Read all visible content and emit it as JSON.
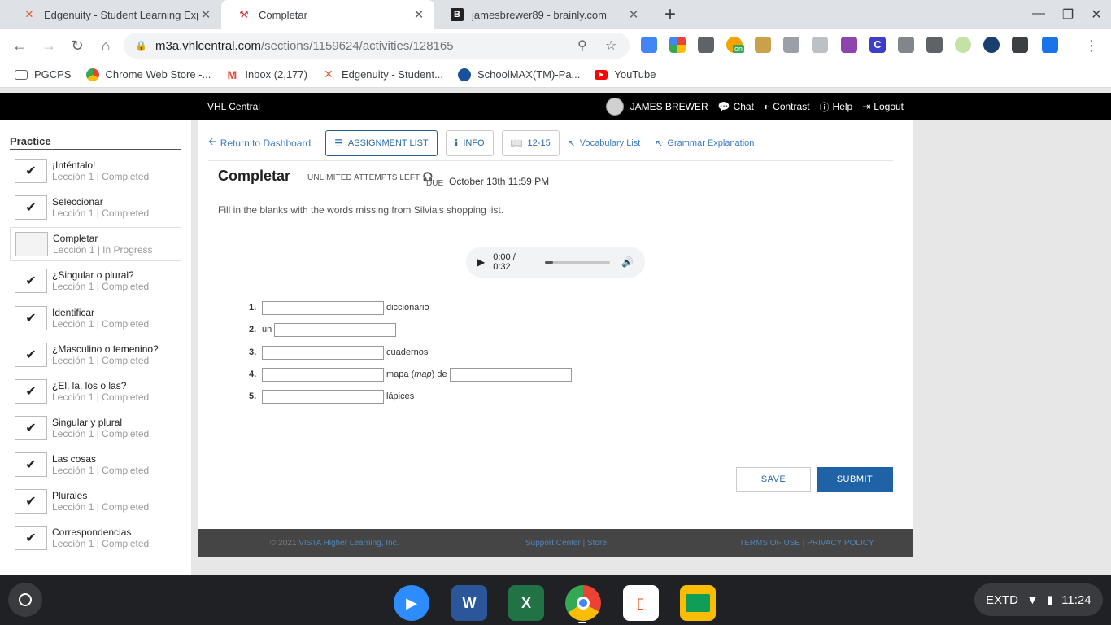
{
  "browser": {
    "tabs": [
      {
        "title": "Edgenuity - Student Learning Exp",
        "favicon": "edgenuity-icon"
      },
      {
        "title": "Completar",
        "favicon": "vhl-icon"
      },
      {
        "title": "jamesbrewer89 - brainly.com",
        "favicon": "brainly-icon"
      }
    ],
    "url_host": "m3a.vhlcentral.com",
    "url_path": "/sections/1159624/activities/128165",
    "extension_badge": "on",
    "bookmarks": [
      {
        "label": "PGCPS",
        "icon": "folder-icon"
      },
      {
        "label": "Chrome Web Store -...",
        "icon": "chrome-web-store-icon"
      },
      {
        "label": "Inbox (2,177)",
        "icon": "gmail-icon"
      },
      {
        "label": "Edgenuity - Student...",
        "icon": "edgenuity-icon"
      },
      {
        "label": "SchoolMAX(TM)-Pa...",
        "icon": "schoolmax-icon"
      },
      {
        "label": "YouTube",
        "icon": "youtube-icon"
      }
    ]
  },
  "vhl_header": {
    "brand": "VHL Central",
    "user": "JAMES BREWER",
    "chat": "Chat",
    "contrast": "Contrast",
    "help": "Help",
    "logout": "Logout"
  },
  "sidebar": {
    "title": "Practice",
    "items": [
      {
        "name": "¡Inténtalo!",
        "lesson": "Lección 1",
        "status": "Completed",
        "done": true
      },
      {
        "name": "Seleccionar",
        "lesson": "Lección 1",
        "status": "Completed",
        "done": true
      },
      {
        "name": "Completar",
        "lesson": "Lección 1",
        "status": "In Progress",
        "done": false
      },
      {
        "name": "¿Singular o plural?",
        "lesson": "Lección 1",
        "status": "Completed",
        "done": true
      },
      {
        "name": "Identificar",
        "lesson": "Lección 1",
        "status": "Completed",
        "done": true
      },
      {
        "name": "¿Masculino o femenino?",
        "lesson": "Lección 1",
        "status": "Completed",
        "done": true
      },
      {
        "name": "¿El, la, los o las?",
        "lesson": "Lección 1",
        "status": "Completed",
        "done": true
      },
      {
        "name": "Singular y plural",
        "lesson": "Lección 1",
        "status": "Completed",
        "done": true
      },
      {
        "name": "Las cosas",
        "lesson": "Lección 1",
        "status": "Completed",
        "done": true
      },
      {
        "name": "Plurales",
        "lesson": "Lección 1",
        "status": "Completed",
        "done": true
      },
      {
        "name": "Correspondencias",
        "lesson": "Lección 1",
        "status": "Completed",
        "done": true
      }
    ]
  },
  "topnav": {
    "return": "Return to Dashboard",
    "assignment_list": "ASSIGNMENT LIST",
    "info": "INFO",
    "pages": "12-15",
    "vocab": "Vocabulary List",
    "grammar": "Grammar Explanation"
  },
  "activity": {
    "title": "Completar",
    "attempts": "UNLIMITED ATTEMPTS LEFT",
    "due_label": "DUE",
    "due_value": "October 13th 11:59 PM",
    "instructions": "Fill in the blanks with the words missing from Silvia's shopping list.",
    "audio_time": "0:00 / 0:32",
    "audio_progress": 0.0,
    "questions": {
      "q1": {
        "num": "1.",
        "after": "diccionario"
      },
      "q2": {
        "num": "2.",
        "before": "un"
      },
      "q3": {
        "num": "3.",
        "after": "cuadernos"
      },
      "q4": {
        "num": "4.",
        "middle_a": "mapa (",
        "middle_i": "map",
        "middle_b": ") de"
      },
      "q5": {
        "num": "5.",
        "after": "lápices"
      }
    },
    "save": "SAVE",
    "submit": "SUBMIT"
  },
  "footer": {
    "copyright": "© 2021",
    "company": "VISTA Higher Learning, Inc.",
    "support": "Support Center",
    "store": "Store",
    "terms": "TERMS OF USE",
    "privacy": "PRIVACY POLICY"
  },
  "taskbar": {
    "apps": [
      "zoom-icon",
      "word-icon",
      "excel-icon",
      "chrome-icon",
      "office-icon",
      "classroom-icon"
    ],
    "tray_label": "EXTD",
    "clock": "11:24"
  },
  "colors": {
    "accent": "#1f63a6",
    "link": "#3a7bbf",
    "vhl_bar": "#000000",
    "footer": "#454545"
  }
}
